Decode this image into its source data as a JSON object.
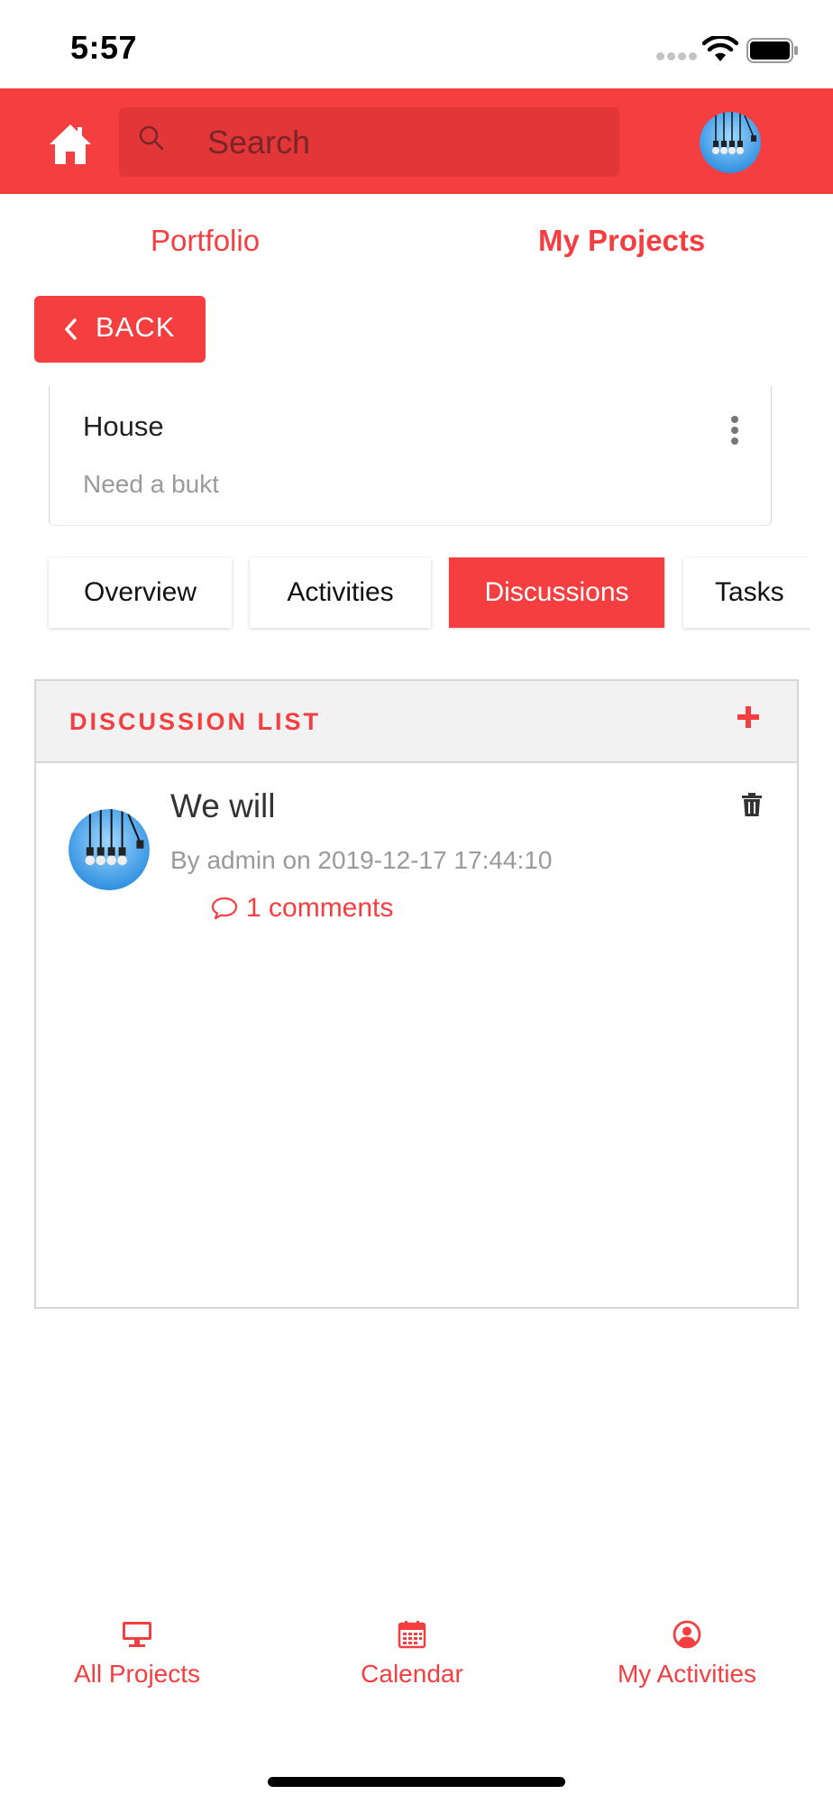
{
  "status_bar": {
    "time": "5:57"
  },
  "header": {
    "search_placeholder": "Search",
    "accent_color": "#f43e40"
  },
  "top_tabs": [
    {
      "label": "Portfolio",
      "active": false
    },
    {
      "label": "My Projects",
      "active": true
    }
  ],
  "back_button": {
    "label": "BACK"
  },
  "project": {
    "title": "House",
    "description": "Need a bukt"
  },
  "project_tabs": [
    {
      "label": "Overview",
      "active": false
    },
    {
      "label": "Activities",
      "active": false
    },
    {
      "label": "Discussions",
      "active": true
    },
    {
      "label": "Tasks",
      "active": false
    }
  ],
  "discussion_list": {
    "title": "DISCUSSION LIST",
    "items": [
      {
        "title": "We will",
        "meta": "By admin on 2019-12-17 17:44:10",
        "comments": "1 comments"
      }
    ]
  },
  "bottom_nav": [
    {
      "label": "All Projects",
      "icon": "desktop-icon"
    },
    {
      "label": "Calendar",
      "icon": "calendar-icon"
    },
    {
      "label": "My Activities",
      "icon": "user-circle-icon"
    }
  ]
}
